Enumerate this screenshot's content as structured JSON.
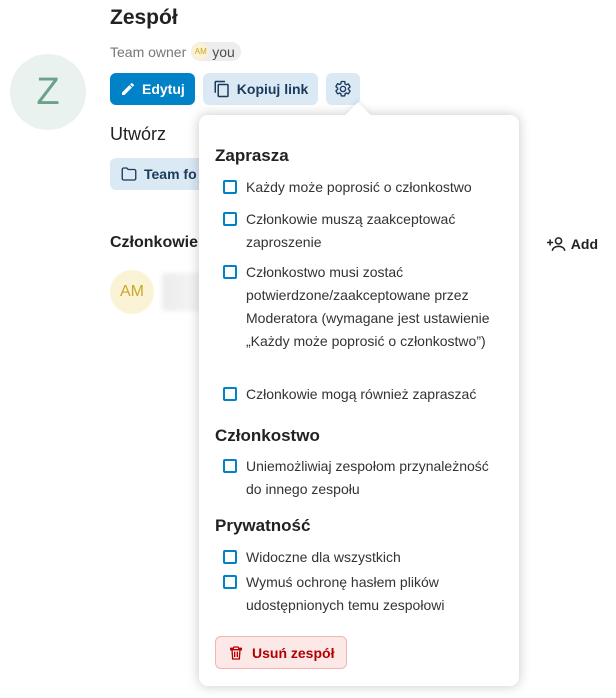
{
  "team": {
    "name": "Zespół",
    "initial": "Z",
    "owner_label": "Team owner",
    "owner_initials": "AM",
    "owner_name": "you"
  },
  "actions": {
    "edit_label": "Edytuj",
    "copy_link_label": "Kopiuj link"
  },
  "create": {
    "heading": "Utwórz",
    "team_folder_label": "Team fo"
  },
  "members": {
    "heading": "Członkowie",
    "add_label": "Add",
    "rows": [
      {
        "initials": "AM"
      }
    ]
  },
  "settings_popover": {
    "sections": [
      {
        "title": "Zaprasza",
        "options": [
          "Każdy może poprosić o członkostwo",
          "Członkowie muszą zaakceptować zaproszenie",
          "Członkostwo musi zostać potwierdzone/zaakceptowane przez Moderatora (wymagane jest ustawienie „Każdy może poprosić o członkostwo”)",
          "Członkowie mogą również zapraszać"
        ]
      },
      {
        "title": "Członkostwo",
        "options": [
          "Uniemożliwiaj zespołom przynależność do innego zespołu"
        ]
      },
      {
        "title": "Prywatność",
        "options": [
          "Widoczne dla wszystkich",
          "Wymuś ochronę hasłem plików udostępnionych temu zespołowi"
        ]
      }
    ],
    "delete_label": "Usuń zespół"
  },
  "colors": {
    "primary": "#0082c9",
    "secondary_bg": "#dbe9f5",
    "danger": "#b30000"
  }
}
